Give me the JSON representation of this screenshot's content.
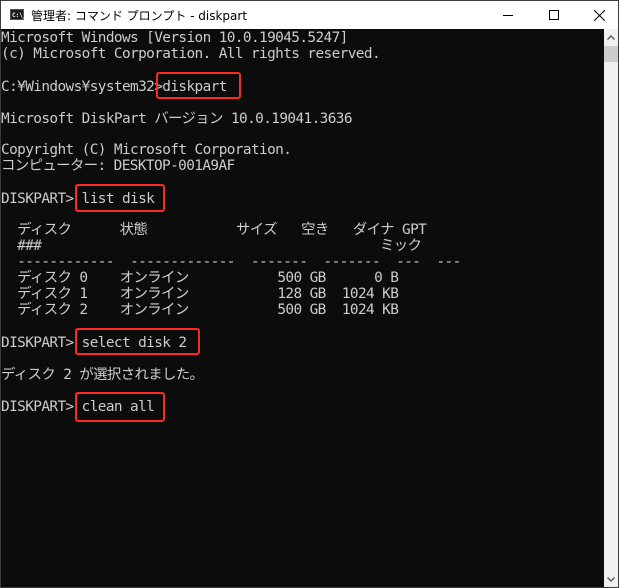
{
  "window": {
    "title": "管理者: コマンド プロンプト - diskpart",
    "icon": "cmd-icon",
    "icon_text": "C:\\_",
    "controls": {
      "minimize": "minimize-icon",
      "maximize": "maximize-icon",
      "close": "close-icon"
    }
  },
  "console": {
    "lines": [
      "Microsoft Windows [Version 10.0.19045.5247]",
      "(c) Microsoft Corporation. All rights reserved.",
      "",
      "C:¥Windows¥system32>diskpart",
      "",
      "Microsoft DiskPart バージョン 10.0.19041.3636",
      "",
      "Copyright (C) Microsoft Corporation.",
      "コンピューター: DESKTOP-001A9AF",
      "",
      "DISKPART> list disk",
      "",
      "  ディスク      状態           サイズ   空き   ダイナ GPT",
      "  ###                                          ミック",
      "  ------------  -------------  -------  -------  ---  ---",
      "  ディスク 0    オンライン           500 GB      0 B",
      "  ディスク 1    オンライン           128 GB  1024 KB",
      "  ディスク 2    オンライン           500 GB  1024 KB",
      "",
      "DISKPART> select disk 2",
      "",
      "ディスク 2 が選択されました。",
      "",
      "DISKPART> clean all"
    ],
    "highlighted_commands": [
      "diskpart",
      "list disk",
      "select disk 2",
      "clean all"
    ]
  },
  "disk_table": {
    "columns": [
      "ディスク ###",
      "状態",
      "サイズ",
      "空き",
      "ダイナミック",
      "GPT"
    ],
    "rows": [
      {
        "disk": "ディスク 0",
        "status": "オンライン",
        "size": "500 GB",
        "free": "0 B",
        "dyn": "",
        "gpt": ""
      },
      {
        "disk": "ディスク 1",
        "status": "オンライン",
        "size": "128 GB",
        "free": "1024 KB",
        "dyn": "",
        "gpt": ""
      },
      {
        "disk": "ディスク 2",
        "status": "オンライン",
        "size": "500 GB",
        "free": "1024 KB",
        "dyn": "",
        "gpt": ""
      }
    ]
  },
  "colors": {
    "console_bg": "#0c0c0c",
    "console_fg": "#cccccc",
    "highlight": "#ff2a1e"
  }
}
